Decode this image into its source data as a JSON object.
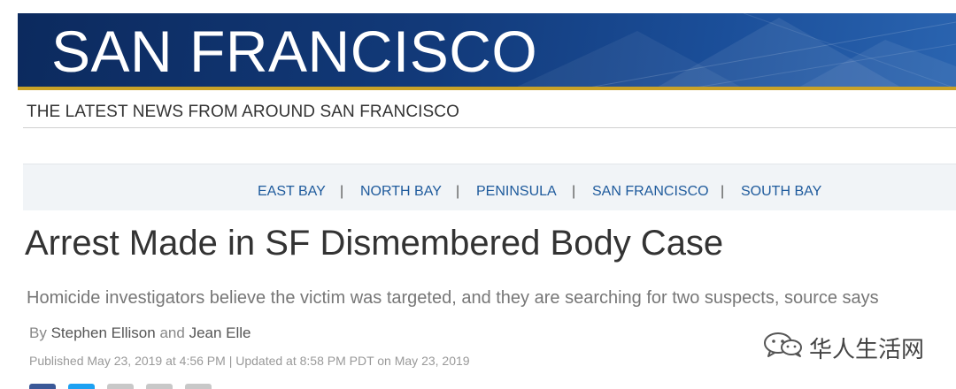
{
  "masthead": {
    "title": "SAN FRANCISCO",
    "tagline": "THE LATEST NEWS FROM AROUND SAN FRANCISCO",
    "accent_color": "#c9a227",
    "banner_color": "#123a7a"
  },
  "nav": {
    "items": [
      {
        "label": "EAST BAY"
      },
      {
        "label": "NORTH BAY"
      },
      {
        "label": "PENINSULA"
      },
      {
        "label": "SAN FRANCISCO"
      },
      {
        "label": "SOUTH BAY"
      }
    ],
    "separator": "|",
    "link_color": "#1e5a9c"
  },
  "article": {
    "headline": "Arrest Made in SF Dismembered Body Case",
    "dek": "Homicide investigators believe the victim was targeted, and they are searching for two suspects, source says",
    "byline": {
      "prefix": "By",
      "author1": "Stephen Ellison",
      "conjunction": "and",
      "author2": "Jean Elle"
    },
    "dateline": "Published May 23, 2019 at 4:56 PM | Updated at 8:58 PM PDT on May 23, 2019"
  },
  "share": {
    "icons": [
      "facebook-icon",
      "twitter-icon",
      "share-icon",
      "email-icon",
      "print-icon"
    ]
  },
  "watermark": {
    "icon": "wechat-icon",
    "text": "华人生活网"
  }
}
